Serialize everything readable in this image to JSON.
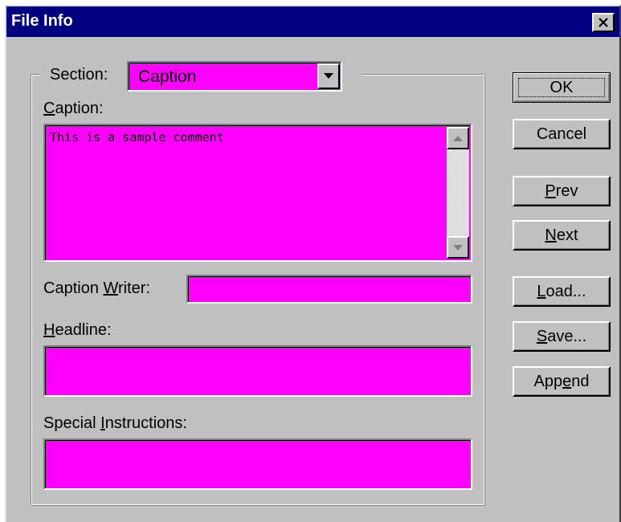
{
  "window": {
    "title": "File Info",
    "close_icon": "close-x-icon"
  },
  "section": {
    "label": "Section:",
    "selected": "Caption",
    "dropdown_icon": "chevron-down-icon"
  },
  "caption": {
    "label_pre": "",
    "label_key": "C",
    "label_post": "aption:",
    "value": "This is a sample comment"
  },
  "caption_writer": {
    "label_pre": "Caption ",
    "label_key": "W",
    "label_post": "riter:",
    "value": ""
  },
  "headline": {
    "label_pre": "",
    "label_key": "H",
    "label_post": "eadline:",
    "value": ""
  },
  "special_instructions": {
    "label_pre": "Special ",
    "label_key": "I",
    "label_post": "nstructions:",
    "value": ""
  },
  "buttons": {
    "ok": "OK",
    "cancel": "Cancel",
    "prev": {
      "pre": "",
      "key": "P",
      "post": "rev"
    },
    "next": {
      "pre": "",
      "key": "N",
      "post": "ext"
    },
    "load": {
      "pre": "",
      "key": "L",
      "post": "oad..."
    },
    "save": {
      "pre": "",
      "key": "S",
      "post": "ave..."
    },
    "append": {
      "pre": "App",
      "key": "e",
      "post": "nd"
    }
  },
  "colors": {
    "field_bg": "#ff00ff",
    "dialog_bg": "#c0c0c0",
    "titlebar": "#000080"
  }
}
